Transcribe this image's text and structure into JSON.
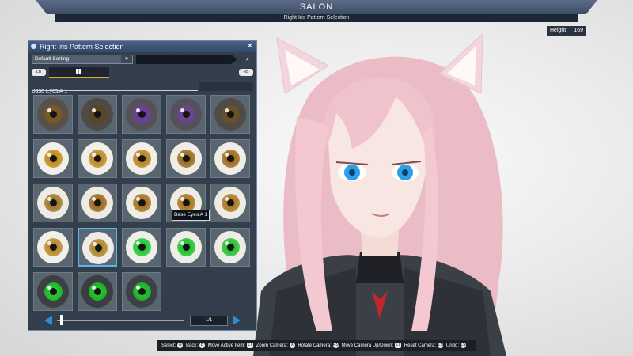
{
  "header": {
    "title": "SALON",
    "subtitle": "Right Iris Pattern Selection"
  },
  "height_display": {
    "label": "Height",
    "value": "169"
  },
  "panel": {
    "title": "Right Iris Pattern Selection",
    "sort_value": "Default Sorting",
    "search_placeholder": "",
    "lb_label": "LB",
    "rb_label": "RB",
    "category": "Base Eyes A 1",
    "tooltip": "Base Eyes A 1",
    "page": "1/1",
    "selected_index": 16,
    "items": [
      {
        "ring": "#57514a",
        "iris": "#7a5a24"
      },
      {
        "ring": "#4f4a45",
        "iris": "#5a4520"
      },
      {
        "ring": "#55505a",
        "iris": "#6c3f9a"
      },
      {
        "ring": "#56505d",
        "iris": "#6a4592"
      },
      {
        "ring": "#4f4b46",
        "iris": "#6b5227"
      },
      {
        "ring": "#f2f0ea",
        "iris": "#c48a1c"
      },
      {
        "ring": "#f1efe8",
        "iris": "#bd8a28"
      },
      {
        "ring": "#f0eee7",
        "iris": "#b98424"
      },
      {
        "ring": "#efede6",
        "iris": "#9a6a1e"
      },
      {
        "ring": "#f0eee8",
        "iris": "#a06c1c"
      },
      {
        "ring": "#eeece5",
        "iris": "#a0782a"
      },
      {
        "ring": "#eceae3",
        "iris": "#9b6a20"
      },
      {
        "ring": "#efede6",
        "iris": "#a6721f"
      },
      {
        "ring": "#eeece5",
        "iris": "#a8761f"
      },
      {
        "ring": "#edebe4",
        "iris": "#a87a22"
      },
      {
        "ring": "#f2f0ea",
        "iris": "#b8892e"
      },
      {
        "ring": "#eeece6",
        "iris": "#b2852c"
      },
      {
        "ring": "#f0eee8",
        "iris": "#22c832"
      },
      {
        "ring": "#efede7",
        "iris": "#1fc22d"
      },
      {
        "ring": "#eeece6",
        "iris": "#26c230"
      },
      {
        "ring": "#3c3f43",
        "iris": "#22cc2c"
      },
      {
        "ring": "#3a3d41",
        "iris": "#20c52a"
      },
      {
        "ring": "#3d4044",
        "iris": "#1fc52c"
      }
    ]
  },
  "help_bar": {
    "text1": "Select:",
    "text2": "Back:",
    "text3": "Move Active Item:",
    "text4": "Zoom Camera:",
    "text5": "Rotate Camera:",
    "text6": "Move Camera Up/Down:",
    "text7": "Reset Camera:",
    "text8": "Undo:",
    "btn_a": "A",
    "btn_b": "B",
    "btn_lt": "LT",
    "btn_x": "X",
    "btn_rs": "RS",
    "btn_lt2": "LT",
    "btn_rt": "RT",
    "btn_y": "Y",
    "btn_ls": "LS",
    "btn_ls2": "LS"
  },
  "colors": {
    "accent": "#56b7e8",
    "tab_underline": "#e0a92a",
    "panel_bg": "#263242",
    "hair": "#f0c3cc",
    "eyes": "#2aa0e6"
  }
}
